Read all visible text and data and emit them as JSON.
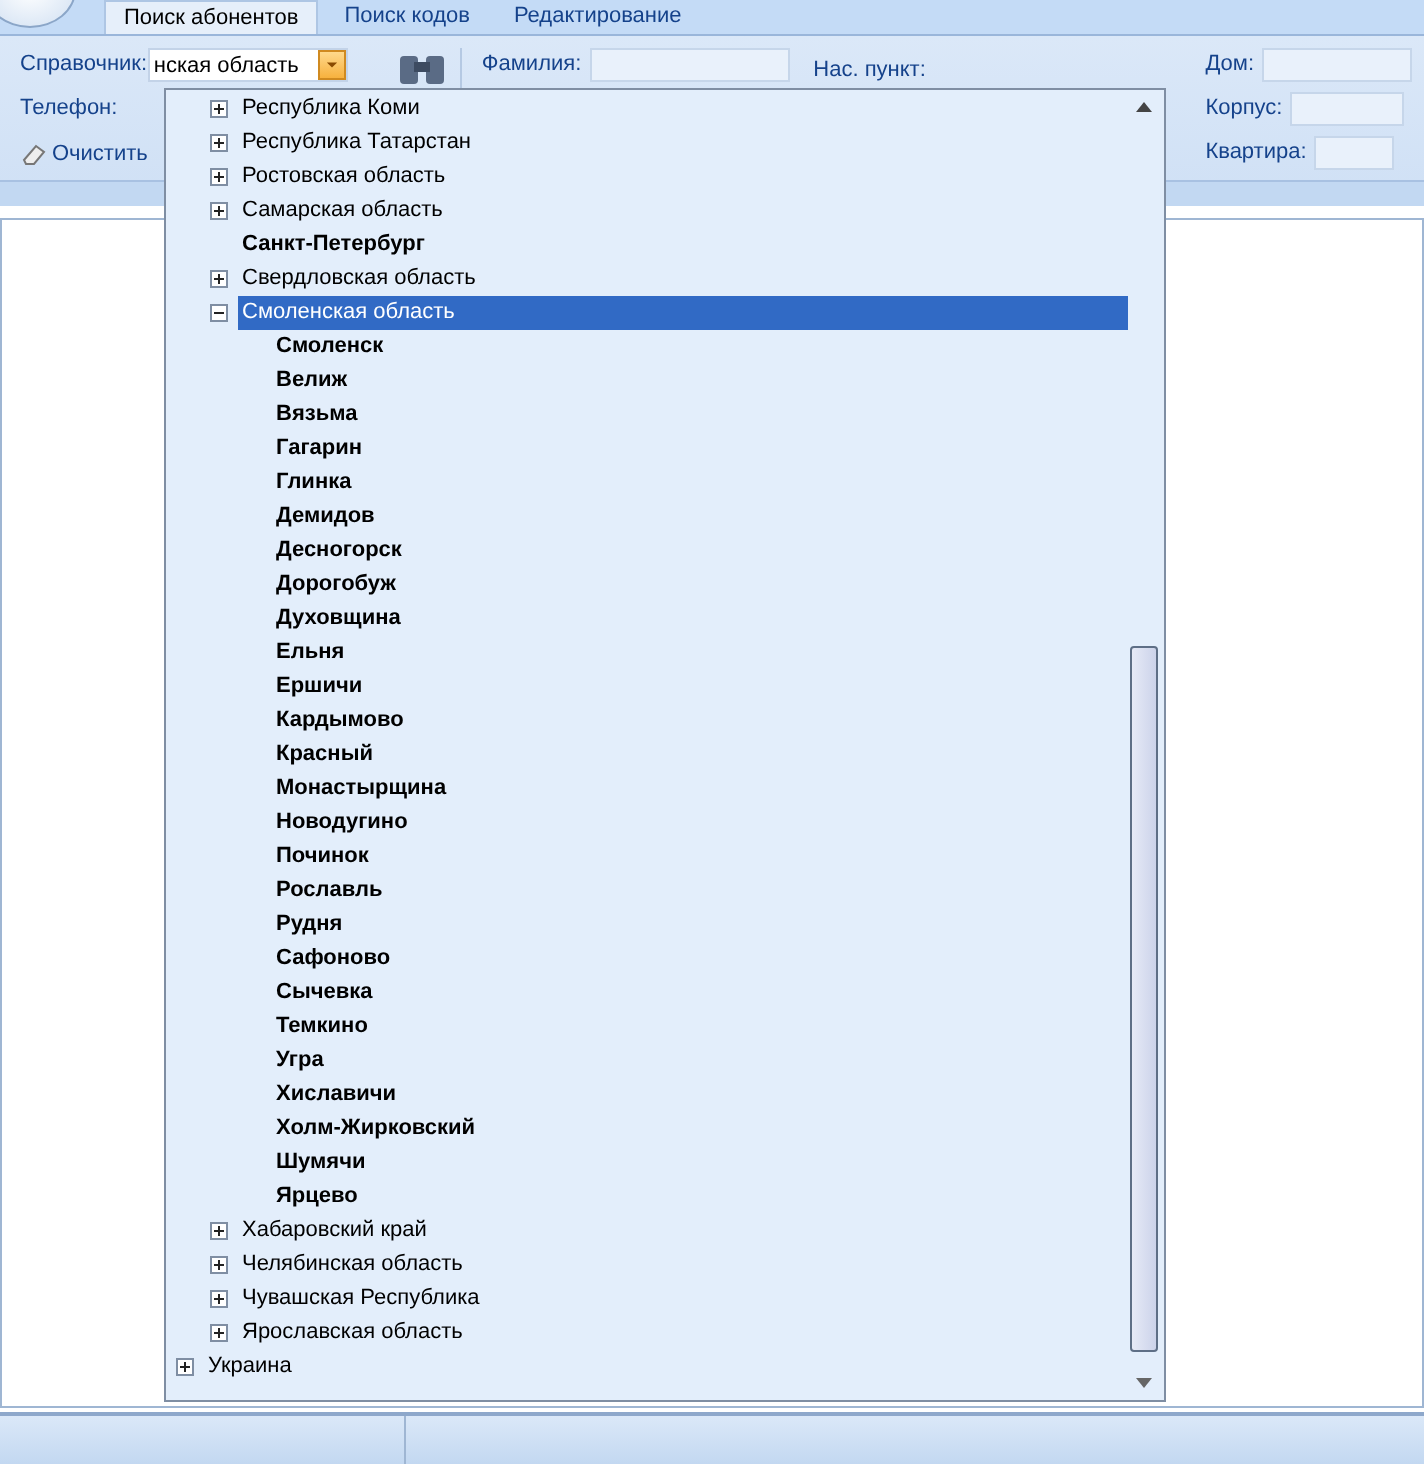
{
  "tabs": [
    {
      "label": "Поиск абонентов",
      "selected": true
    },
    {
      "label": "Поиск кодов",
      "selected": false
    },
    {
      "label": "Редактирование",
      "selected": false
    }
  ],
  "filters": {
    "directory_label": "Справочник:",
    "directory_value": "нская область",
    "phone_label": "Телефон:",
    "clear_button": "Очистить",
    "surname_label": "Фамилия:",
    "locality_label": "Нас. пункт:",
    "house_label": "Дом:",
    "building_label": "Корпус:",
    "apartment_label": "Квартира:"
  },
  "tree": [
    {
      "kind": "hidden",
      "children": [
        {
          "kind": "group",
          "label": "Республика Коми",
          "expanded": false,
          "selected": false
        },
        {
          "kind": "group",
          "label": "Республика Татарстан",
          "expanded": false,
          "selected": false
        },
        {
          "kind": "group",
          "label": "Ростовская область",
          "expanded": false,
          "selected": false
        },
        {
          "kind": "group",
          "label": "Самарская область",
          "expanded": false,
          "selected": false
        },
        {
          "kind": "leaf",
          "label": "Санкт-Петербург",
          "selected": false
        },
        {
          "kind": "group",
          "label": "Свердловская область",
          "expanded": false,
          "selected": false
        },
        {
          "kind": "group",
          "label": "Смоленская область",
          "expanded": true,
          "selected": true,
          "children": [
            {
              "kind": "leaf",
              "label": "Смоленск",
              "selected": false
            },
            {
              "kind": "leaf",
              "label": "Велиж",
              "selected": false
            },
            {
              "kind": "leaf",
              "label": "Вязьма",
              "selected": false
            },
            {
              "kind": "leaf",
              "label": "Гагарин",
              "selected": false
            },
            {
              "kind": "leaf",
              "label": "Глинка",
              "selected": false
            },
            {
              "kind": "leaf",
              "label": "Демидов",
              "selected": false
            },
            {
              "kind": "leaf",
              "label": "Десногорск",
              "selected": false
            },
            {
              "kind": "leaf",
              "label": "Дорогобуж",
              "selected": false
            },
            {
              "kind": "leaf",
              "label": "Духовщина",
              "selected": false
            },
            {
              "kind": "leaf",
              "label": "Ельня",
              "selected": false
            },
            {
              "kind": "leaf",
              "label": "Ершичи",
              "selected": false
            },
            {
              "kind": "leaf",
              "label": "Кардымово",
              "selected": false
            },
            {
              "kind": "leaf",
              "label": "Красный",
              "selected": false
            },
            {
              "kind": "leaf",
              "label": "Монастырщина",
              "selected": false
            },
            {
              "kind": "leaf",
              "label": "Новодугино",
              "selected": false
            },
            {
              "kind": "leaf",
              "label": "Починок",
              "selected": false
            },
            {
              "kind": "leaf",
              "label": "Рославль",
              "selected": false
            },
            {
              "kind": "leaf",
              "label": "Рудня",
              "selected": false
            },
            {
              "kind": "leaf",
              "label": "Сафоново",
              "selected": false
            },
            {
              "kind": "leaf",
              "label": "Сычевка",
              "selected": false
            },
            {
              "kind": "leaf",
              "label": "Темкино",
              "selected": false
            },
            {
              "kind": "leaf",
              "label": "Угра",
              "selected": false
            },
            {
              "kind": "leaf",
              "label": "Хиславичи",
              "selected": false
            },
            {
              "kind": "leaf",
              "label": "Холм-Жирковский",
              "selected": false
            },
            {
              "kind": "leaf",
              "label": "Шумячи",
              "selected": false
            },
            {
              "kind": "leaf",
              "label": "Ярцево",
              "selected": false
            }
          ]
        },
        {
          "kind": "group",
          "label": "Хабаровский край",
          "expanded": false,
          "selected": false
        },
        {
          "kind": "group",
          "label": "Челябинская область",
          "expanded": false,
          "selected": false
        },
        {
          "kind": "group",
          "label": "Чувашская Республика",
          "expanded": false,
          "selected": false
        },
        {
          "kind": "group",
          "label": "Ярославская область",
          "expanded": false,
          "selected": false
        }
      ]
    },
    {
      "kind": "group",
      "label": "Украина",
      "expanded": false,
      "selected": false
    }
  ]
}
